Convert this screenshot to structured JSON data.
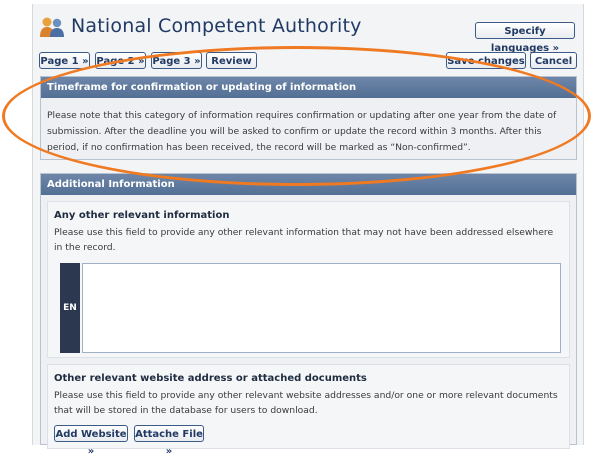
{
  "header": {
    "title": "National Competent Authority",
    "specify_languages": "Specify languages »"
  },
  "nav": {
    "page1": "Page 1 »",
    "page2": "Page 2 »",
    "page3": "Page 3 »",
    "review": "Review »",
    "save": "Save changes »",
    "cancel": "Cancel"
  },
  "timeframe": {
    "heading": "Timeframe for confirmation or updating of information",
    "text": "Please note that this category of information requires confirmation or updating after one year from the date of submission. After the deadline you will be asked to confirm or update the record within 3 months. After this period, if no confirmation has been received, the record will be marked as “Non-confirmed”."
  },
  "additional": {
    "heading": "Additional Information",
    "other_info": {
      "title": "Any other relevant information",
      "description": "Please use this field to provide any other relevant information that may not have been addressed elsewhere in the record.",
      "lang": "EN"
    },
    "website": {
      "title": "Other relevant website address or attached documents",
      "description": "Please use this field to provide any other relevant website addresses and/or one or more relevant documents that will be stored in the database for users to download.",
      "add_website": "Add Website »",
      "attach_file": "Attache File »"
    }
  },
  "colors": {
    "accent": "#213a64",
    "section_header": "#5f7aa0",
    "highlight": "#f07a22"
  }
}
